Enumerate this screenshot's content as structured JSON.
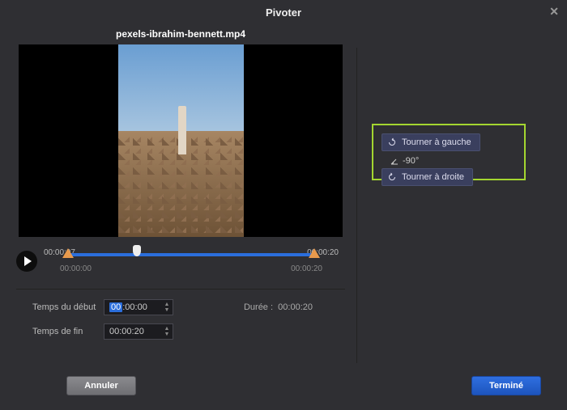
{
  "title": "Pivoter",
  "filename": "pexels-ibrahim-bennett.mp4",
  "playback": {
    "current_time": "00:00:07",
    "total_time": "00:00:20",
    "range_start": "00:00:00",
    "range_end": "00:00:20"
  },
  "fields": {
    "start_label": "Temps du début",
    "end_label": "Temps de fin",
    "start_value_prefix": "00",
    "start_value_suffix": ":00:00",
    "end_value": "00:00:20",
    "duration_label": "Durée :",
    "duration_value": "00:00:20"
  },
  "rotate": {
    "left_label": "Tourner à gauche",
    "right_label": "Tourner à droite",
    "angle": "-90°"
  },
  "buttons": {
    "cancel": "Annuler",
    "done": "Terminé"
  }
}
